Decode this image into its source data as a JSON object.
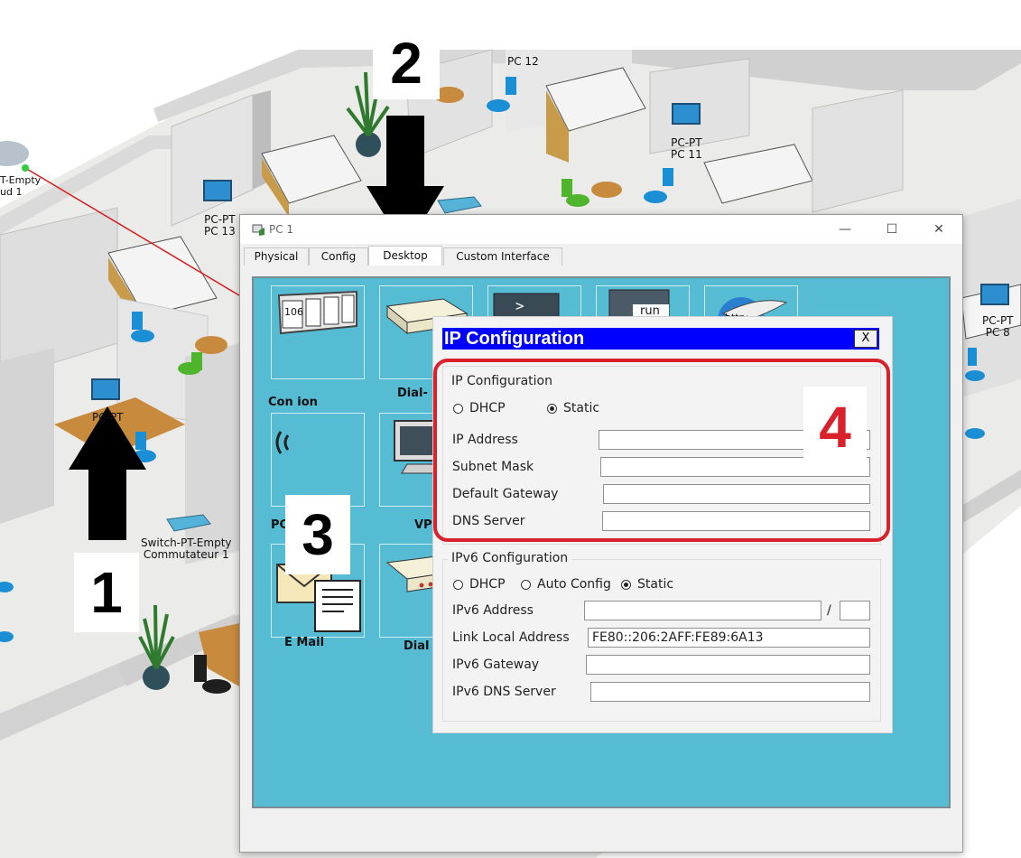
{
  "scene": {
    "device_labels": {
      "cloud_line1": "T-Empty",
      "cloud_line2": "ud 1",
      "pc12": "PC 12",
      "pc11_line1": "PC-PT",
      "pc11_line2": "PC 11",
      "pc13_line1": "PC-PT",
      "pc13_line2": "PC 13",
      "pc_left": "PC-PT",
      "pc8_line1": "PC-PT",
      "pc8_line2": "PC 8",
      "switch_line1": "Switch-PT-Empty",
      "switch_line2": "Commutateur 1"
    },
    "step_numbers": [
      "1",
      "2",
      "3",
      "4"
    ]
  },
  "window": {
    "title": "PC 1",
    "controls": {
      "minimize": "—",
      "maximize": "☐",
      "close": "✕"
    },
    "tabs": [
      "Physical",
      "Config",
      "Desktop",
      "Custom Interface"
    ],
    "active_tab": "Desktop"
  },
  "desktop": {
    "tiles": {
      "ip_config_badge": "106",
      "cmd_prompt": ">",
      "run_label": "run",
      "browser_text": "http:"
    },
    "labels": {
      "ip_configuration": "Con        ion",
      "dial": "Dial-",
      "pc_wireless": "PC        s",
      "vpn": "VP",
      "email": "E Mail",
      "dialog_bottom": "Dial"
    }
  },
  "ip_dialog": {
    "title": "IP Configuration",
    "close": "X",
    "ipv4": {
      "group_title": "IP Configuration",
      "dhcp": "DHCP",
      "static": "Static",
      "mode": "Static",
      "ip_address_label": "IP Address",
      "ip_address": "",
      "subnet_mask_label": "Subnet Mask",
      "subnet_mask": "",
      "default_gateway_label": "Default Gateway",
      "default_gateway": "",
      "dns_server_label": "DNS Server",
      "dns_server": ""
    },
    "ipv6": {
      "group_title": "IPv6 Configuration",
      "dhcp": "DHCP",
      "auto_config": "Auto Config",
      "static": "Static",
      "mode": "Static",
      "ipv6_address_label": "IPv6 Address",
      "ipv6_address": "",
      "prefix_separator": "/",
      "prefix_length": "",
      "link_local_label": "Link Local Address",
      "link_local_address": "FE80::206:2AFF:FE89:6A13",
      "gateway_label": "IPv6 Gateway",
      "gateway": "",
      "dns_label": "IPv6 DNS Server",
      "dns": ""
    }
  },
  "colors": {
    "desktop_bg": "#55bcd4",
    "dialog_title_bg": "#0000ff",
    "highlight_red": "#d9212c",
    "link_line": "#d81c1c"
  }
}
